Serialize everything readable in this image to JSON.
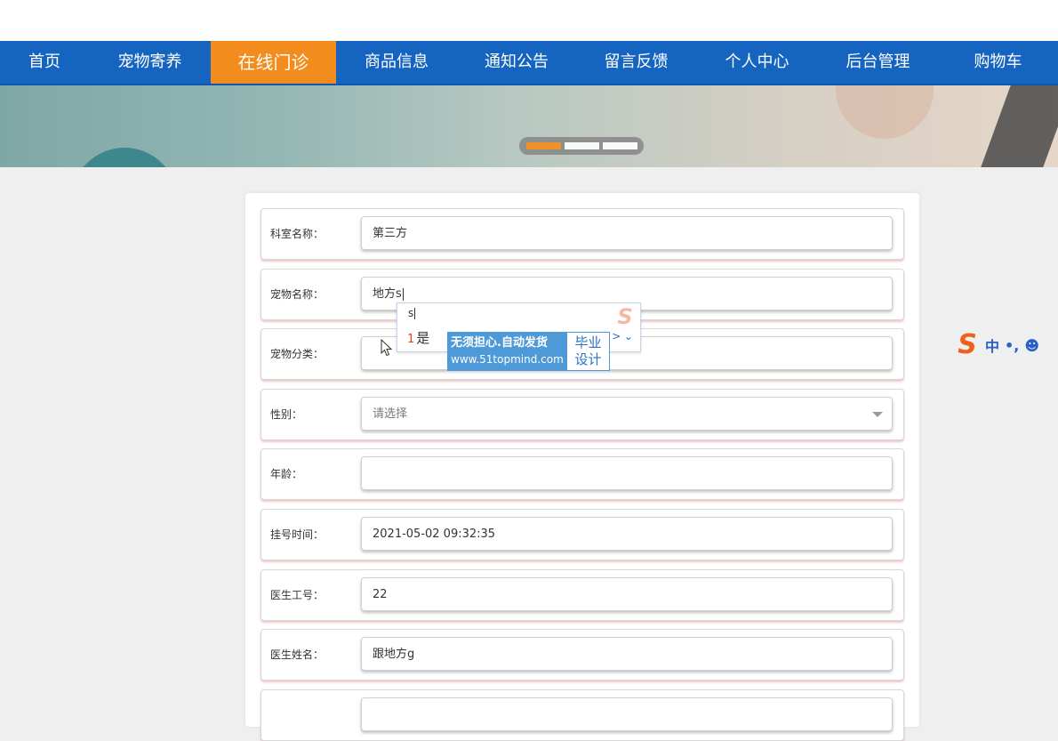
{
  "nav": {
    "items": [
      {
        "label": "首页"
      },
      {
        "label": "宠物寄养"
      },
      {
        "label": "在线门诊",
        "active": true
      },
      {
        "label": "商品信息"
      },
      {
        "label": "通知公告"
      },
      {
        "label": "留言反馈"
      },
      {
        "label": "个人中心"
      },
      {
        "label": "后台管理"
      },
      {
        "label": "购物车"
      }
    ]
  },
  "carousel": {
    "active_index": 0,
    "count": 3
  },
  "form": {
    "rows": [
      {
        "label": "科室名称：",
        "value": "第三方"
      },
      {
        "label": "宠物名称：",
        "value": "地方s"
      },
      {
        "label": "宠物分类：",
        "value": ""
      },
      {
        "label": "性别：",
        "placeholder": "请选择"
      },
      {
        "label": "年龄：",
        "value": ""
      },
      {
        "label": "挂号时间：",
        "value": "2021-05-02 09:32:35"
      },
      {
        "label": "医生工号：",
        "value": "22"
      },
      {
        "label": "医生姓名：",
        "value": "跟地方g"
      }
    ]
  },
  "ime_popup": {
    "composition": "s",
    "candidate_number": "1",
    "candidate": "是",
    "more_glyph": "> ⌄"
  },
  "ad_overlay": {
    "text": "无须担心.自动发货",
    "url": "www.51topmind.com",
    "badge_line1": "毕业",
    "badge_line2": "设计"
  },
  "ime_toolbar": {
    "logo": "S",
    "mode": "中",
    "punct": "•,",
    "emoji": "☻"
  },
  "colors": {
    "nav_bg": "#1565c0",
    "nav_active": "#f28c1c",
    "page_bg": "#efefef"
  }
}
